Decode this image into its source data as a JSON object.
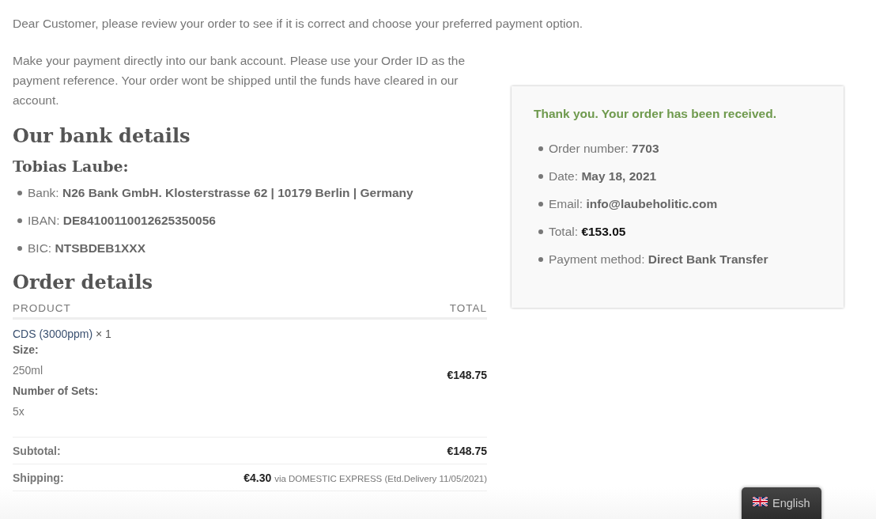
{
  "intro": "Dear Customer, please review your order to see if it is correct and choose your preferred payment option.",
  "instructions": "Make your payment directly into our bank account. Please use your Order ID as the payment reference. Your order wont be shipped until the funds have cleared in our account.",
  "bank_heading": "Our bank details",
  "account_name": "Tobias Laube:",
  "bank_details": [
    {
      "label": "Bank:",
      "value": "N26 Bank GmbH. Klosterstrasse 62 | 10179 Berlin | Germany"
    },
    {
      "label": "IBAN:",
      "value": "DE84100110012625350056"
    },
    {
      "label": "BIC:",
      "value": "NTSBDEB1XXX"
    }
  ],
  "order_heading": "Order details",
  "table": {
    "columns": [
      "PRODUCT",
      "TOTAL"
    ],
    "item": {
      "product": "CDS (3000ppm)",
      "quantity": "× 1",
      "meta": [
        {
          "label": "Size:",
          "value": "250ml"
        },
        {
          "label": "Number of Sets:",
          "value": "5x"
        }
      ],
      "total": "€148.75"
    },
    "totals": [
      {
        "label": "Subtotal:",
        "amount": "€148.75"
      },
      {
        "label": "Shipping:",
        "amount": "€4.30",
        "note": "via DOMESTIC EXPRESS (Etd.Delivery 11/05/2021)"
      }
    ]
  },
  "confirmation": {
    "title": "Thank you. Your order has been received.",
    "items": [
      {
        "label": "Order number:",
        "value": "7703",
        "strong": false
      },
      {
        "label": "Date:",
        "value": "May 18, 2021",
        "strong": false
      },
      {
        "label": "Email:",
        "value": "info@laubeholitic.com",
        "strong": false
      },
      {
        "label": "Total:",
        "value": "€153.05",
        "strong": true
      },
      {
        "label": "Payment method:",
        "value": "Direct Bank Transfer",
        "strong": false
      }
    ]
  },
  "language_switcher": {
    "label": "English"
  }
}
